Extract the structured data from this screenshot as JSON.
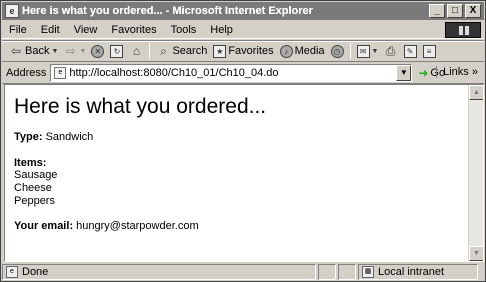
{
  "window": {
    "title": "Here is what you ordered... - Microsoft Internet Explorer",
    "minimize": "_",
    "maximize": "□",
    "close": "X"
  },
  "menu": [
    "File",
    "Edit",
    "View",
    "Favorites",
    "Tools",
    "Help"
  ],
  "toolbar": {
    "back": "Back",
    "search": "Search",
    "favorites": "Favorites",
    "media": "Media"
  },
  "address": {
    "label": "Address",
    "url": "http://localhost:8080/Ch10_01/Ch10_04.do",
    "go": "Go",
    "links": "Links"
  },
  "page": {
    "heading": "Here is what you ordered...",
    "type_label": "Type",
    "type_value": "Sandwich",
    "items_label": "Items",
    "items": [
      "Sausage",
      "Cheese",
      "Peppers"
    ],
    "email_label": "Your email",
    "email_value": "hungry@starpowder.com"
  },
  "status": {
    "text": "Done",
    "zone": "Local intranet"
  }
}
